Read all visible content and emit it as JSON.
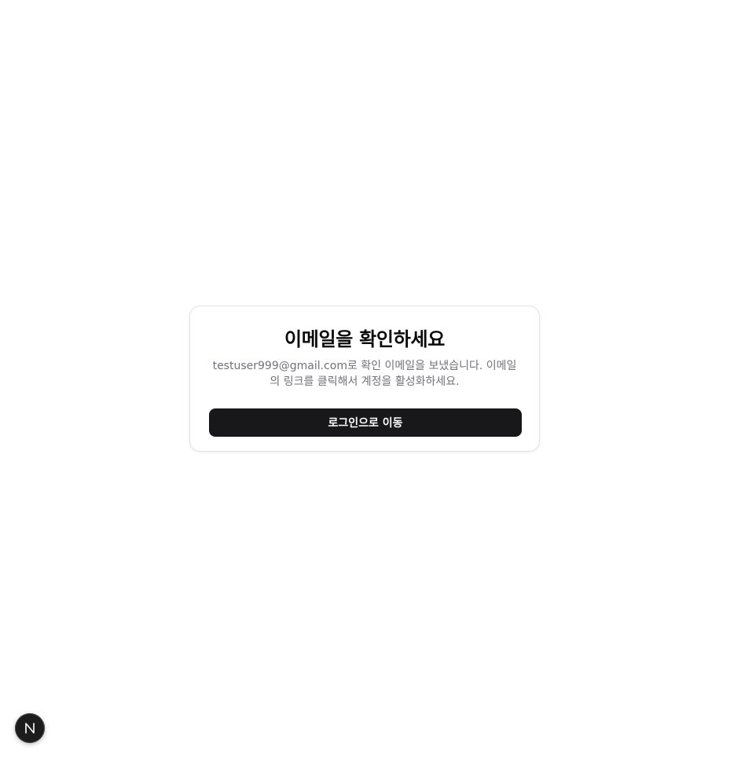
{
  "card": {
    "title": "이메일을 확인하세요",
    "description": "testuser999@gmail.com로 확인 이메일을 보냈습니다. 이메일의 링크를 클릭해서 계정을 활성화하세요.",
    "button_label": "로그인으로 이동"
  },
  "dev_badge": {
    "icon": "nextjs-logo-icon",
    "letter": "N"
  },
  "colors": {
    "background": "#ffffff",
    "button_bg": "#18181b",
    "button_text": "#fafafa",
    "muted_text": "#71717a"
  }
}
